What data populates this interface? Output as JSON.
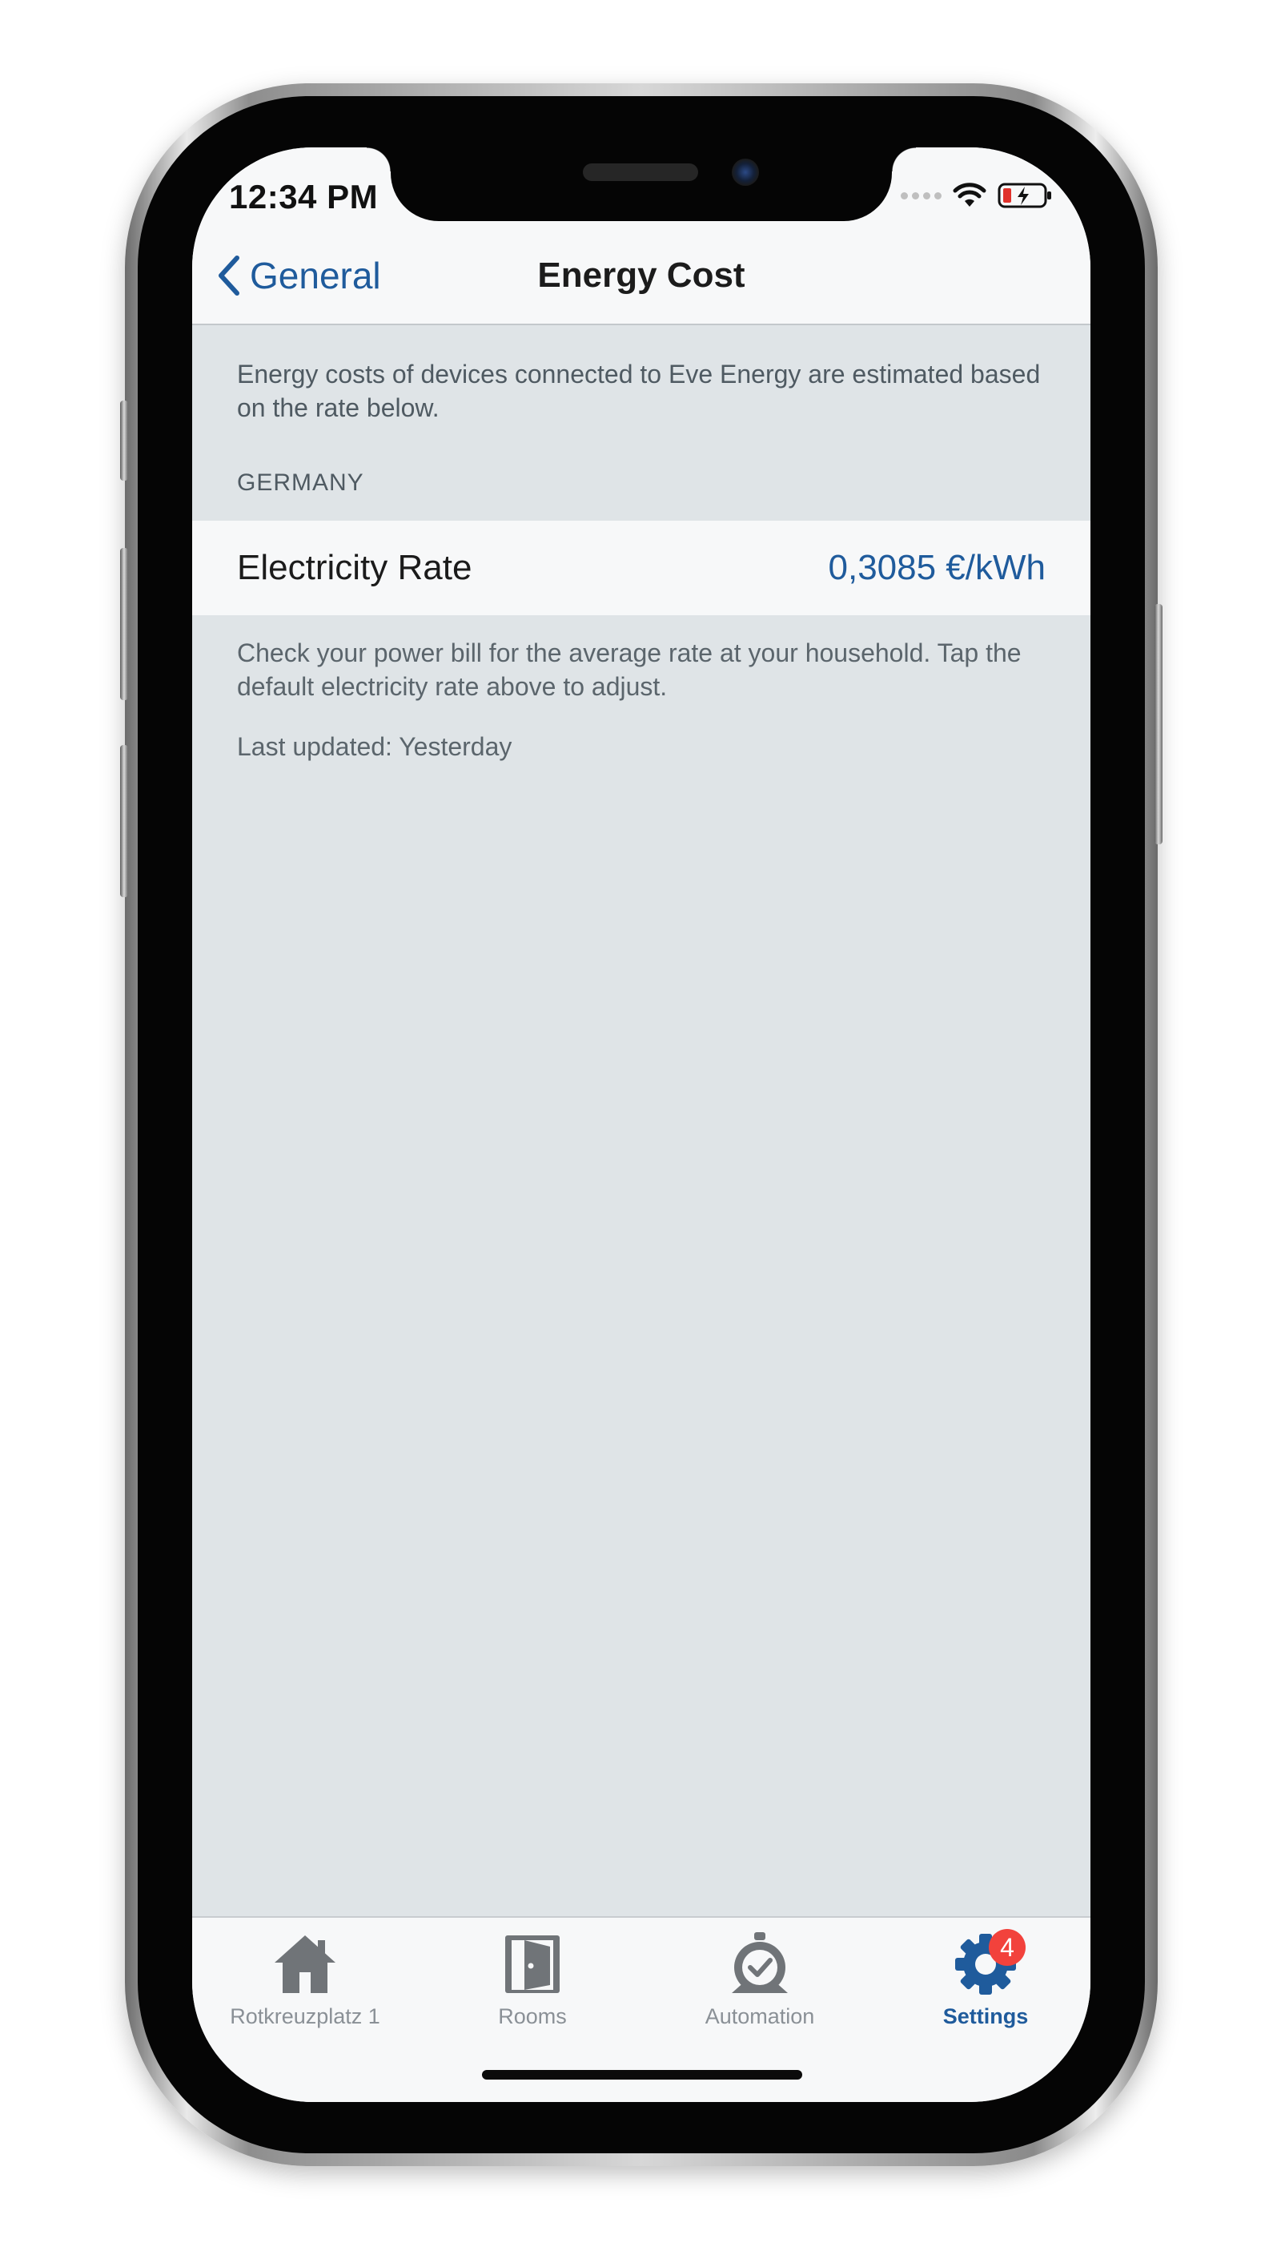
{
  "status_bar": {
    "time": "12:34 PM"
  },
  "nav": {
    "back_label": "General",
    "title": "Energy Cost"
  },
  "content": {
    "intro": "Energy costs of devices connected to Eve Energy are estimated based on the rate below.",
    "section_header": "GERMANY",
    "rate_label": "Electricity Rate",
    "rate_value": "0,3085 €/kWh",
    "footer": "Check your power bill for the average rate at your household. Tap the default electricity rate above to adjust.",
    "last_updated": "Last updated: Yesterday"
  },
  "tabs": [
    {
      "label": "Rotkreuzplatz 1",
      "icon": "house-icon",
      "active": false
    },
    {
      "label": "Rooms",
      "icon": "door-icon",
      "active": false
    },
    {
      "label": "Automation",
      "icon": "automation-clock-icon",
      "active": false
    },
    {
      "label": "Settings",
      "icon": "gear-icon",
      "active": true,
      "badge": "4"
    }
  ],
  "colors": {
    "accent": "#1f5b9c",
    "background": "#dfe4e7",
    "badge": "#f2423c",
    "inactive_tab": "#8a9096"
  }
}
